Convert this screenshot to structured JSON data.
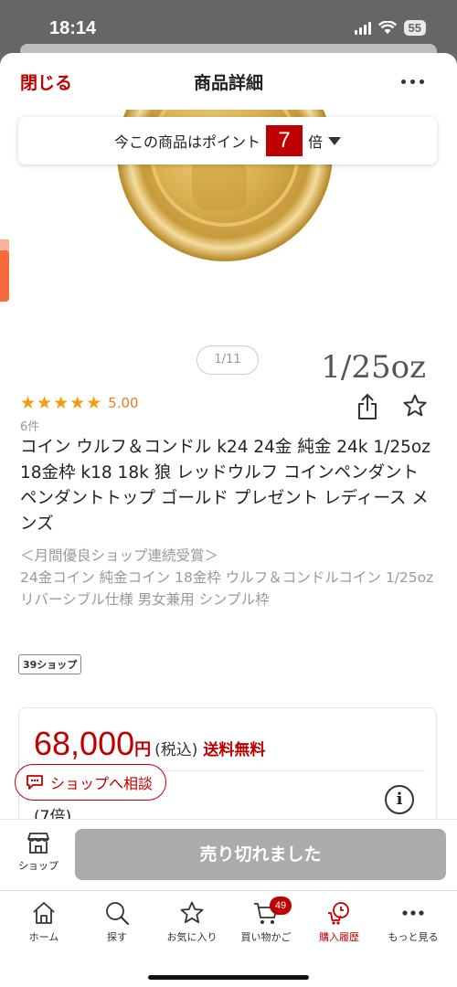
{
  "status": {
    "time": "18:14",
    "battery": "55"
  },
  "header": {
    "close_label": "閉じる",
    "title": "商品詳細"
  },
  "point_bar": {
    "prefix": "今この商品はポイント",
    "multiplier": "7",
    "suffix": "倍"
  },
  "image": {
    "oz_label": "1/25oz",
    "page_indicator": "1/11"
  },
  "rating": {
    "stars": "★★★★★",
    "value": "5.00",
    "count": "6件"
  },
  "product": {
    "title": "コイン ウルフ＆コンドル k24 24金 純金 24k 1/25oz 18金枠 k18 18k 狼 レッドウルフ コインペンダント ペンダントトップ ゴールド プレゼント レディース メンズ",
    "catch_lines": [
      "＜月間優良ショップ連続受賞＞",
      "24金コイン 純金コイン 18金枠 ウルフ＆コンドルコイン 1/25oz",
      "リバーシブル仕様 男女兼用 シンプル枠"
    ],
    "shop_badge": "39ショップ"
  },
  "price": {
    "amount": "68,000",
    "yen": "円",
    "tax": "(税込)",
    "shipping": "送料無料",
    "points_text": "(7倍)"
  },
  "consult_button": {
    "label": "ショップへ相談"
  },
  "action_bar": {
    "shop_label": "ショップ",
    "soldout_label": "売り切れました"
  },
  "tab_bar": {
    "tabs": [
      {
        "label": "ホーム",
        "icon": "home-icon"
      },
      {
        "label": "探す",
        "icon": "search-icon"
      },
      {
        "label": "お気に入り",
        "icon": "star-icon"
      },
      {
        "label": "買い物かご",
        "icon": "cart-icon",
        "badge": "49"
      },
      {
        "label": "購入履歴",
        "icon": "history-icon",
        "active": true
      },
      {
        "label": "もっと見る",
        "icon": "more-icon"
      }
    ]
  },
  "colors": {
    "accent": "#bf0000",
    "star": "#f39c12",
    "soldout": "#ababab"
  }
}
